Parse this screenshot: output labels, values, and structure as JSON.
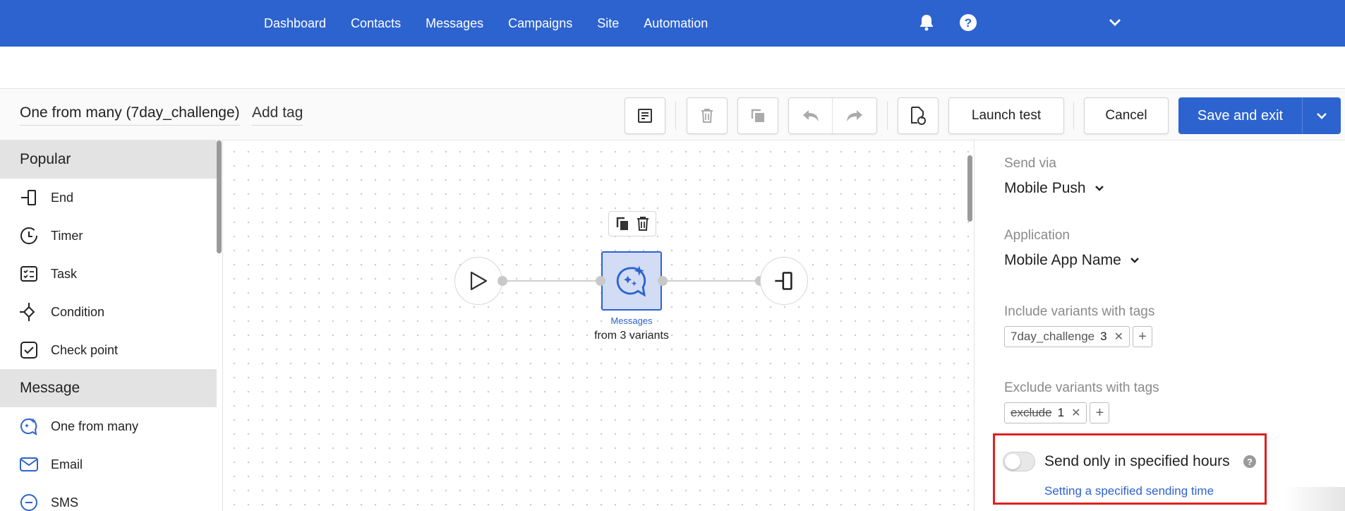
{
  "nav": {
    "links": [
      "Dashboard",
      "Contacts",
      "Messages",
      "Campaigns",
      "Site",
      "Automation"
    ],
    "bell_icon": "bell-icon",
    "help_icon": "help-icon",
    "account_chevron_icon": "chevron-down-icon"
  },
  "toolbar": {
    "flow_title": "One from many (7day_challenge)",
    "add_tag": "Add tag",
    "launch_test": "Launch test",
    "cancel": "Cancel",
    "save_and_exit": "Save and exit"
  },
  "palette": {
    "popular_header": "Popular",
    "popular_items": [
      {
        "label": "End",
        "icon": "end-icon"
      },
      {
        "label": "Timer",
        "icon": "timer-icon"
      },
      {
        "label": "Task",
        "icon": "task-icon"
      },
      {
        "label": "Condition",
        "icon": "condition-icon"
      },
      {
        "label": "Check point",
        "icon": "check-point-icon"
      }
    ],
    "message_header": "Message",
    "message_items": [
      {
        "label": "One from many",
        "icon": "one-from-many-icon"
      },
      {
        "label": "Email",
        "icon": "email-icon"
      },
      {
        "label": "SMS",
        "icon": "sms-icon"
      }
    ]
  },
  "canvas": {
    "node_type": "Messages",
    "node_subtitle": "from 3 variants"
  },
  "panel": {
    "send_via_label": "Send via",
    "send_via_value": "Mobile Push",
    "application_label": "Application",
    "application_value": "Mobile App Name",
    "include_label": "Include variants with tags",
    "include_tag": {
      "name": "7day_challenge",
      "count": "3"
    },
    "exclude_label": "Exclude variants with tags",
    "exclude_tag": {
      "name": "exclude",
      "count": "1"
    },
    "toggle_label": "Send only in specified hours",
    "toggle_on": false,
    "help_text": "?",
    "link_text": "Setting a specified sending time"
  },
  "colors": {
    "brand": "#2d63cf",
    "highlight": "#e02020"
  }
}
